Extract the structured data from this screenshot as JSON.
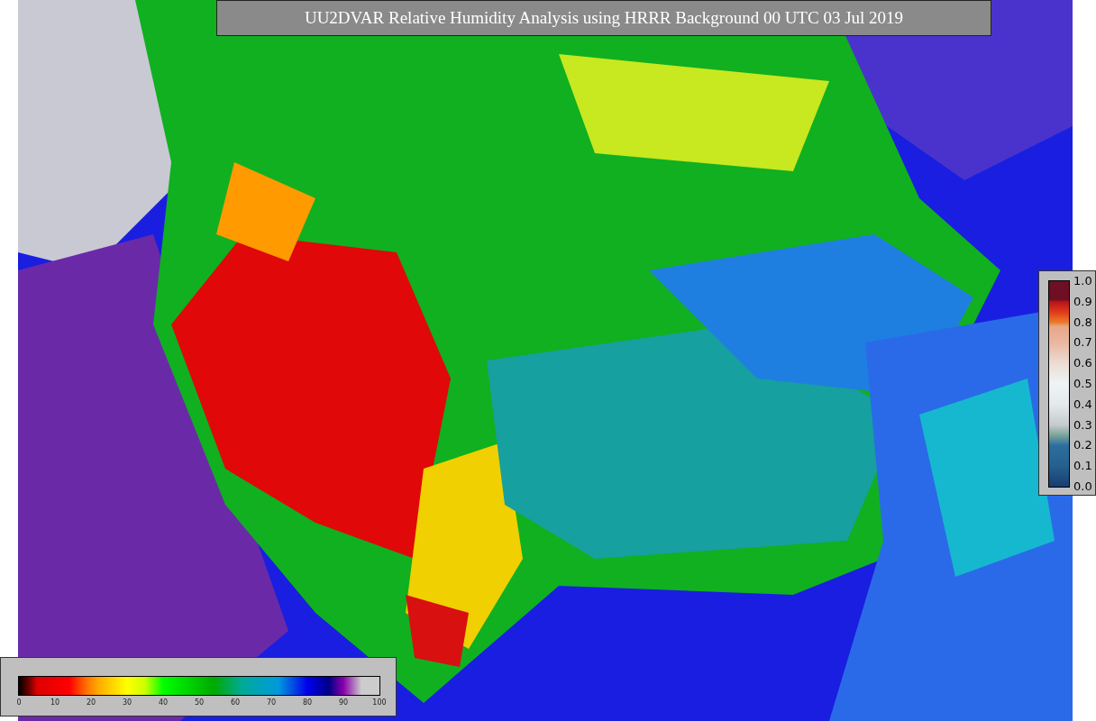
{
  "title": "UU2DVAR Relative Humidity Analysis using HRRR Background 00 UTC 03 Jul 2019",
  "observation_colorbar": {
    "ticks": [
      "1.0",
      "0.9",
      "0.8",
      "0.7",
      "0.6",
      "0.5",
      "0.4",
      "0.3",
      "0.2",
      "0.1",
      "0.0"
    ]
  },
  "humidity_colorbar": {
    "ticks": [
      "0",
      "10",
      "20",
      "30",
      "40",
      "50",
      "60",
      "70",
      "80",
      "90",
      "100"
    ]
  }
}
